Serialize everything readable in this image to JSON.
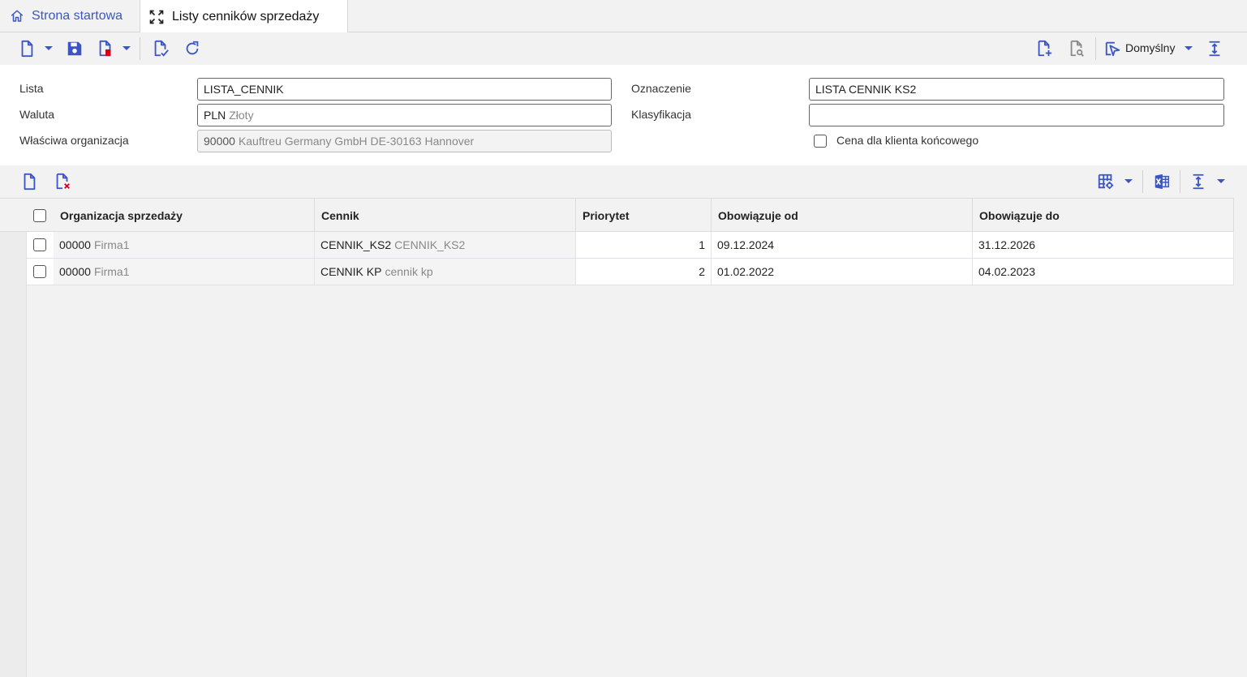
{
  "tabs": {
    "home_label": "Strona startowa",
    "active_label": "Listy cenników sprzedaży"
  },
  "toolbar": {
    "view_label": "Domyślny"
  },
  "form": {
    "lista_label": "Lista",
    "lista_value": "LISTA_CENNIK",
    "waluta_label": "Waluta",
    "waluta_code": "PLN",
    "waluta_desc": "Złoty",
    "org_label": "Właściwa organizacja",
    "org_code": "90000",
    "org_desc": "Kauftreu Germany GmbH DE-30163 Hannover",
    "oznaczenie_label": "Oznaczenie",
    "oznaczenie_value": "LISTA CENNIK KS2",
    "klasyfikacja_label": "Klasyfikacja",
    "klasyfikacja_value": "",
    "end_customer_label": "Cena dla klienta końcowego",
    "end_customer_checked": false
  },
  "grid": {
    "columns": [
      "Organizacja sprzedaży",
      "Cennik",
      "Priorytet",
      "Obowiązuje od",
      "Obowiązuje do"
    ],
    "rows": [
      {
        "org_code": "00000",
        "org_desc": "Firma1",
        "cennik_code": "CENNIK_KS2",
        "cennik_desc": "CENNIK_KS2",
        "priorytet": "1",
        "od": "09.12.2024",
        "do": "31.12.2026"
      },
      {
        "org_code": "00000",
        "org_desc": "Firma1",
        "cennik_code": "CENNIK KP",
        "cennik_desc": "cennik kp",
        "priorytet": "2",
        "od": "01.02.2022",
        "do": "04.02.2023"
      }
    ]
  },
  "colors": {
    "accent": "#3c55c4",
    "delete_red": "#d0021b"
  }
}
